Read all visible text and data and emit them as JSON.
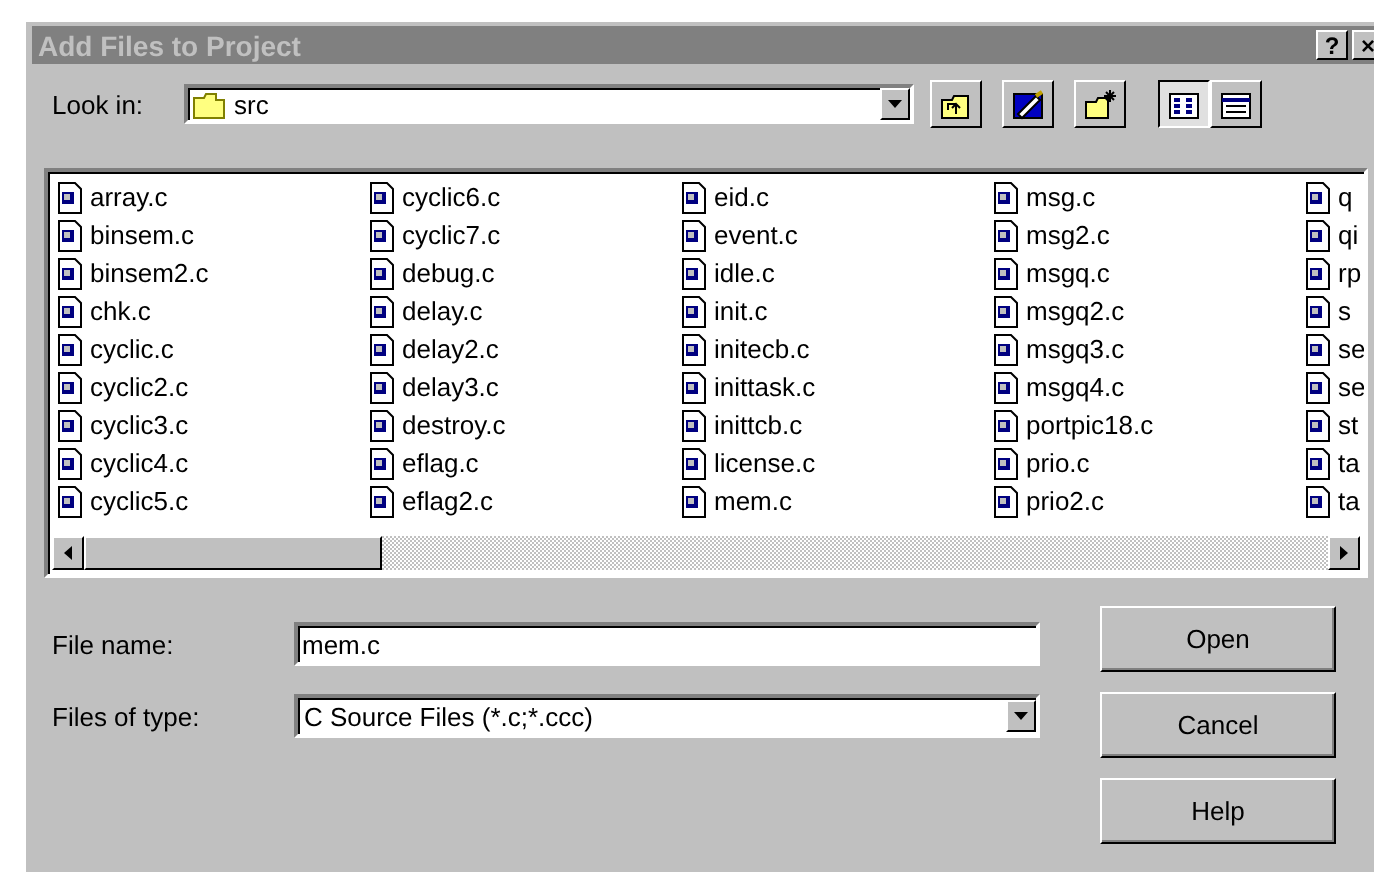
{
  "window": {
    "title": "Add Files to Project",
    "title_buttons": [
      "?",
      "×"
    ]
  },
  "look_in": {
    "label": "Look in:",
    "value": "src"
  },
  "toolbar": [
    {
      "kind": "up"
    },
    {
      "kind": "desktop"
    },
    {
      "kind": "newfolder"
    },
    {
      "kind": "list",
      "selected": true
    },
    {
      "kind": "details",
      "selected": false
    }
  ],
  "files": [
    [
      "array.c",
      "binsem.c",
      "binsem2.c",
      "chk.c",
      "cyclic.c",
      "cyclic2.c",
      "cyclic3.c",
      "cyclic4.c",
      "cyclic5.c"
    ],
    [
      "cyclic6.c",
      "cyclic7.c",
      "debug.c",
      "delay.c",
      "delay2.c",
      "delay3.c",
      "destroy.c",
      "eflag.c",
      "eflag2.c"
    ],
    [
      "eid.c",
      "event.c",
      "idle.c",
      "init.c",
      "initecb.c",
      "inittask.c",
      "inittcb.c",
      "license.c",
      "mem.c"
    ],
    [
      "msg.c",
      "msg2.c",
      "msgq.c",
      "msgq2.c",
      "msgq3.c",
      "msgq4.c",
      "portpic18.c",
      "prio.c",
      "prio2.c"
    ],
    [
      "q",
      "qi",
      "rp",
      "s",
      "se",
      "se",
      "st",
      "ta",
      "ta"
    ]
  ],
  "scrollbar": {
    "level": 0.24
  },
  "file_name": {
    "label": "File name:",
    "value": "mem.c"
  },
  "file_type": {
    "label": "Files of type:",
    "value": "C Source Files (*.c;*.ccc)"
  },
  "buttons": [
    "Open",
    "Cancel",
    "Help"
  ]
}
